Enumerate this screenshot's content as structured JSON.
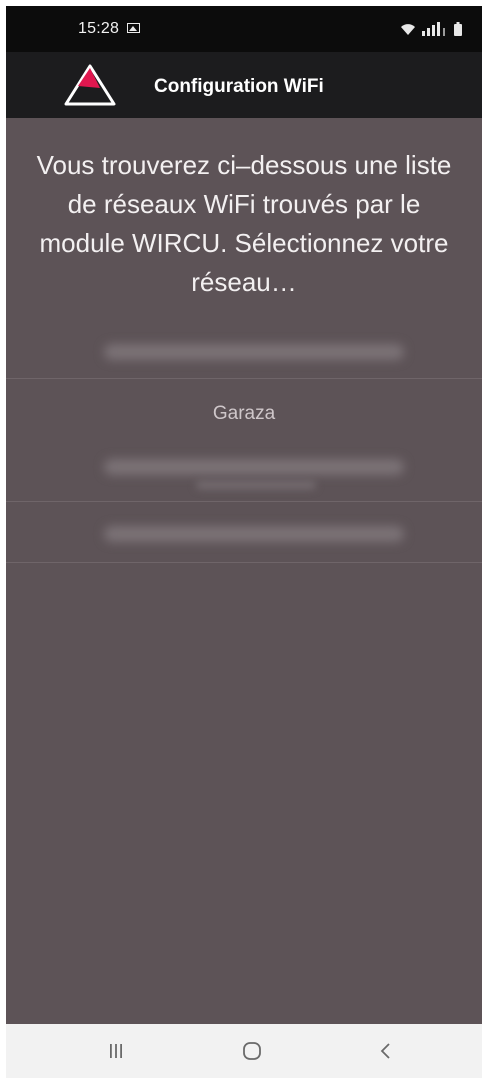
{
  "status_bar": {
    "time": "15:28",
    "icons": [
      "gallery-icon",
      "wifi-icon",
      "signal-icon",
      "battery-icon"
    ]
  },
  "app_bar": {
    "title": "Configuration WiFi",
    "logo_colors": {
      "accent": "#e0174f",
      "outline": "#ffffff"
    }
  },
  "main": {
    "instructions": "Vous trouverez ci–dessous une liste de réseaux WiFi trouvés par le module WIRCU. Sélectionnez votre réseau…",
    "networks": [
      {
        "label": "",
        "redacted": true
      },
      {
        "label": "Garaza",
        "redacted": false
      },
      {
        "label": "",
        "redacted": true
      }
    ]
  },
  "nav_bar": {
    "icons": [
      "recent-apps-icon",
      "home-icon",
      "back-icon"
    ]
  },
  "colors": {
    "background": "#5d5357",
    "app_bar": "#1c1c1e",
    "status_bar": "#0c0c0c",
    "divider": "#6f6569",
    "nav_bar": "#f2f2f2"
  }
}
